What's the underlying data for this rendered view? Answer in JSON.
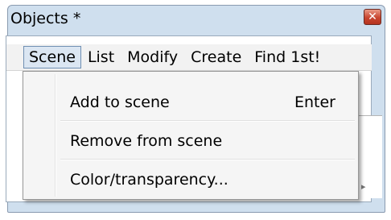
{
  "window": {
    "title": "Objects *",
    "close_glyph": "✕"
  },
  "menubar": {
    "items": [
      "Scene",
      "List",
      "Modify",
      "Create",
      "Find 1st!"
    ]
  },
  "dropdown": {
    "items": [
      {
        "label": "Add to scene",
        "shortcut": "Enter"
      },
      {
        "label": "Remove from scene",
        "shortcut": ""
      },
      {
        "label": "Color/transparency...",
        "shortcut": ""
      }
    ]
  },
  "icons": {
    "scroll_arrow": "▸",
    "close": "close-icon"
  },
  "colors": {
    "frame": "#cfdfee",
    "close_button": "#c8452f",
    "menu_highlight": "#dbe6f2"
  }
}
